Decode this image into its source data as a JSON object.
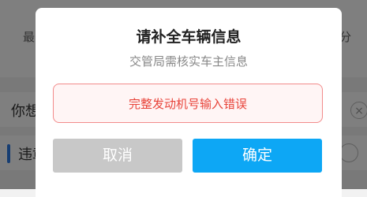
{
  "background": {
    "tab_left_partial": "最",
    "tab_right_partial": "分",
    "row1_partial": "你想",
    "row2_partial": "违章",
    "row1_close_icon": "close-icon",
    "accent_color": "#2c7be5"
  },
  "modal": {
    "title": "请补全车辆信息",
    "subtitle": "交管局需核实车主信息",
    "error_message": "完整发动机号输入错误",
    "cancel_label": "取消",
    "confirm_label": "确定"
  },
  "colors": {
    "confirm_button": "#0da7f5",
    "cancel_button": "#c8c8c8",
    "error_text": "#e8443a",
    "error_border": "#f28b8b"
  }
}
